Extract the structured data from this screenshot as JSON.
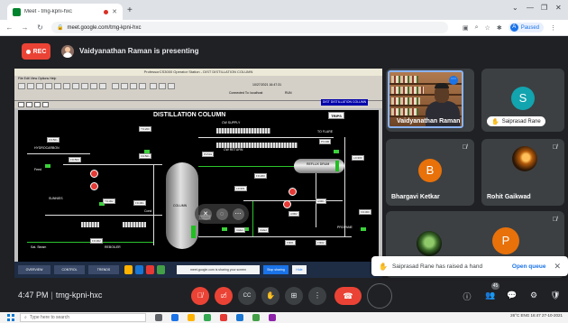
{
  "browser": {
    "tab_title": "Meet - tmg-kpni-hxc",
    "new_tab": "+",
    "url": "meet.google.com/tmg-kpni-hxc",
    "profile_initial": "A",
    "profile_label": "Paused",
    "window_controls": [
      "⌄",
      "—",
      "❐",
      "✕"
    ]
  },
  "meet": {
    "rec_label": "REC",
    "presenter_banner": "Vaidyanathan Raman is presenting",
    "meeting_time": "4:47 PM",
    "meeting_code": "tmg-kpni-hxc",
    "participant_count": "45"
  },
  "shared_screen": {
    "window_title": "ProfessorCS3000 Operator Station - DIST DISTILLATION COLUMN",
    "menu": "File   Edit   View   Options   Help",
    "nav_label": "DIST DISTILLATION COLUMN",
    "time": "10/27/2021   16:47:31",
    "connected": "Connected To: localhost",
    "run": "RUN",
    "diagram_title": "DISTILLATION COLUMN",
    "trips_button": "TRIPS",
    "column_label": "COLUMN",
    "drum_label": "REFLUX DRUM",
    "labels": {
      "hydrocarbon": "HYDROCARBON",
      "feed": "Feed",
      "sunnies": "SUNNIES",
      "sat_steam": "Sat. Steam",
      "reboiler": "REBOILER",
      "to_flare": "TO FLARE",
      "propane": "PROPANE",
      "cond": "Cond",
      "cw_supply": "CW SUPPLY",
      "cw_return": "CW RETURN"
    },
    "tags": [
      "FIC501",
      "FIC503",
      "TIC200",
      "FIC501",
      "PC501",
      "PC400",
      "FIC200",
      "TIC302",
      "LIC200",
      "FIC301",
      "CHE1",
      "CHE2",
      "AI001",
      "AI002",
      "LIC300",
      "FIC300",
      "FIC302",
      "FI301",
      "FI302",
      "LIC301"
    ],
    "tray_text": "meet.google.com is sharing your screen",
    "stop_sharing": "Stop sharing",
    "hide": "Hide",
    "taskbar_items": [
      "OVERVIEW",
      "CONTROL",
      "TRENDS"
    ]
  },
  "participants": [
    {
      "name": "Vaidyanathan Raman",
      "type": "video"
    },
    {
      "name": "Saiprasad Rane",
      "initial": "S",
      "color": "#12a4af",
      "hand_raised": true
    },
    {
      "name": "Bhargavi Ketkar",
      "initial": "B",
      "color": "#e8710a",
      "muted": true
    },
    {
      "name": "Rohit Gaikwad",
      "type": "photo",
      "muted": true
    },
    {
      "name": "",
      "type": "photo-plant",
      "muted": true
    },
    {
      "name": "",
      "initial": "P",
      "color": "#e8710a",
      "muted": true
    }
  ],
  "toast": {
    "message": "Saiprasad Rane has raised a hand",
    "action": "Open queue"
  },
  "controls": {
    "mic": "mic-off",
    "camera": "camera-off",
    "captions": "CC",
    "raise_hand": "hand",
    "present": "present",
    "more": "more",
    "leave": "end-call"
  },
  "windows": {
    "search_placeholder": "Type here to search",
    "tray": "26°C  ENG  16:47  27-10-2021"
  },
  "colors": {
    "meet_bg": "#202124",
    "tile_bg": "#3c4043",
    "rec_red": "#ea4335",
    "accent_blue": "#1a73e8"
  }
}
